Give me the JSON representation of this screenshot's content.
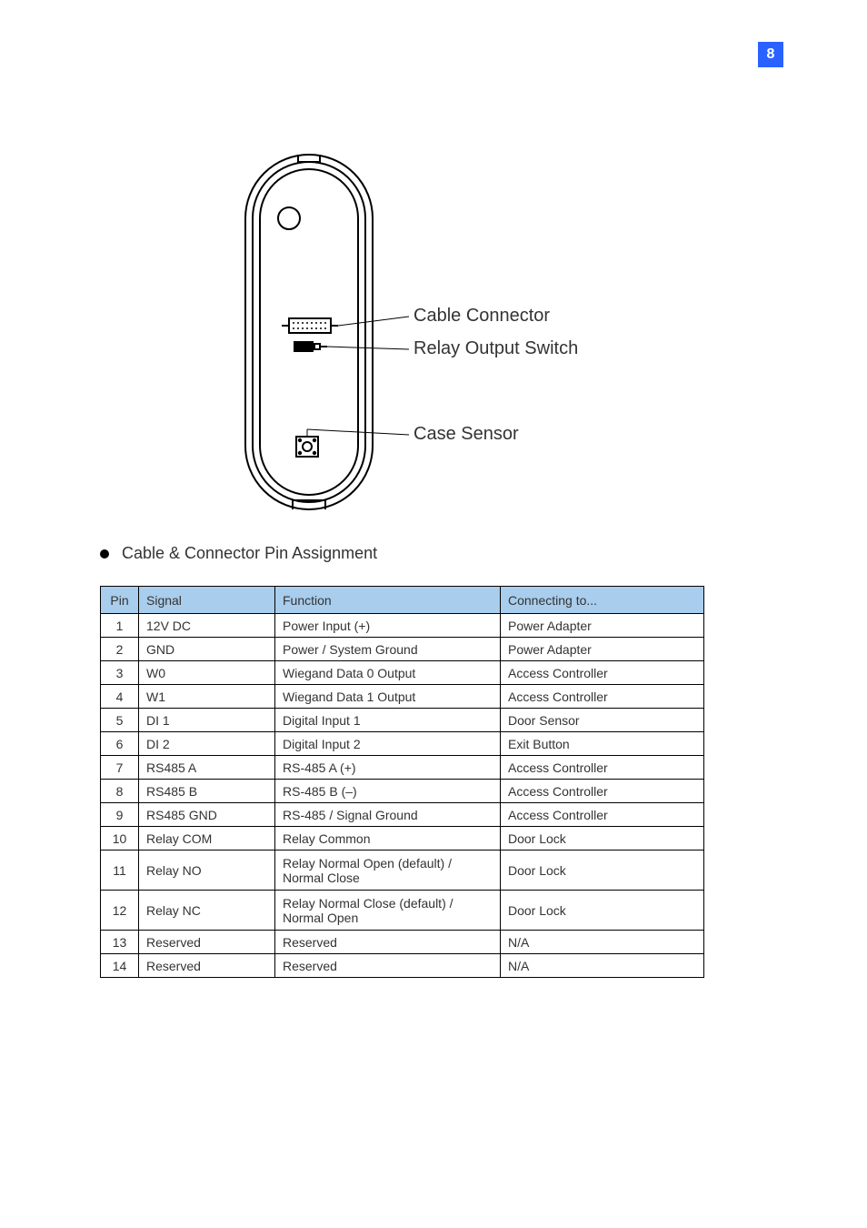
{
  "page_number": "8",
  "callouts": {
    "cable_connector": "Cable Connector",
    "relay_output_switch": "Relay Output Switch",
    "case_sensor": "Case Sensor"
  },
  "bullet_title": "Cable & Connector Pin Assignment",
  "table": {
    "headers": [
      "Pin",
      "Signal",
      "Function",
      "Connecting to..."
    ],
    "rows": [
      {
        "pin": "1",
        "signal": "12V DC",
        "function": "Power Input (+)",
        "connecting": "Power Adapter"
      },
      {
        "pin": "2",
        "signal": "GND",
        "function": "Power / System Ground",
        "connecting": "Power Adapter"
      },
      {
        "pin": "3",
        "signal": "W0",
        "function": "Wiegand Data 0 Output",
        "connecting": "Access Controller"
      },
      {
        "pin": "4",
        "signal": "W1",
        "function": "Wiegand Data 1 Output",
        "connecting": "Access Controller"
      },
      {
        "pin": "5",
        "signal": "DI 1",
        "function": "Digital Input 1",
        "connecting": "Door Sensor"
      },
      {
        "pin": "6",
        "signal": "DI 2",
        "function": "Digital Input 2",
        "connecting": "Exit Button"
      },
      {
        "pin": "7",
        "signal": "RS485 A",
        "function": "RS-485 A (+)",
        "connecting": "Access Controller"
      },
      {
        "pin": "8",
        "signal": "RS485 B",
        "function": "RS-485 B (–)",
        "connecting": "Access Controller"
      },
      {
        "pin": "9",
        "signal": "RS485 GND",
        "function": "RS-485 / Signal Ground",
        "connecting": "Access Controller"
      },
      {
        "pin": "10",
        "signal": "Relay COM",
        "function": "Relay Common",
        "connecting": "Door Lock"
      },
      {
        "pin": "11",
        "signal": "Relay NO",
        "function": "Relay Normal Open (default) / Normal Close",
        "connecting": "Door Lock",
        "tall": true
      },
      {
        "pin": "12",
        "signal": "Relay NC",
        "function": "Relay Normal Close (default) / Normal Open",
        "connecting": "Door Lock",
        "tall": true
      },
      {
        "pin": "13",
        "signal": "Reserved",
        "function": "Reserved",
        "connecting": "N/A"
      },
      {
        "pin": "14",
        "signal": "Reserved",
        "function": "Reserved",
        "connecting": "N/A"
      }
    ]
  }
}
